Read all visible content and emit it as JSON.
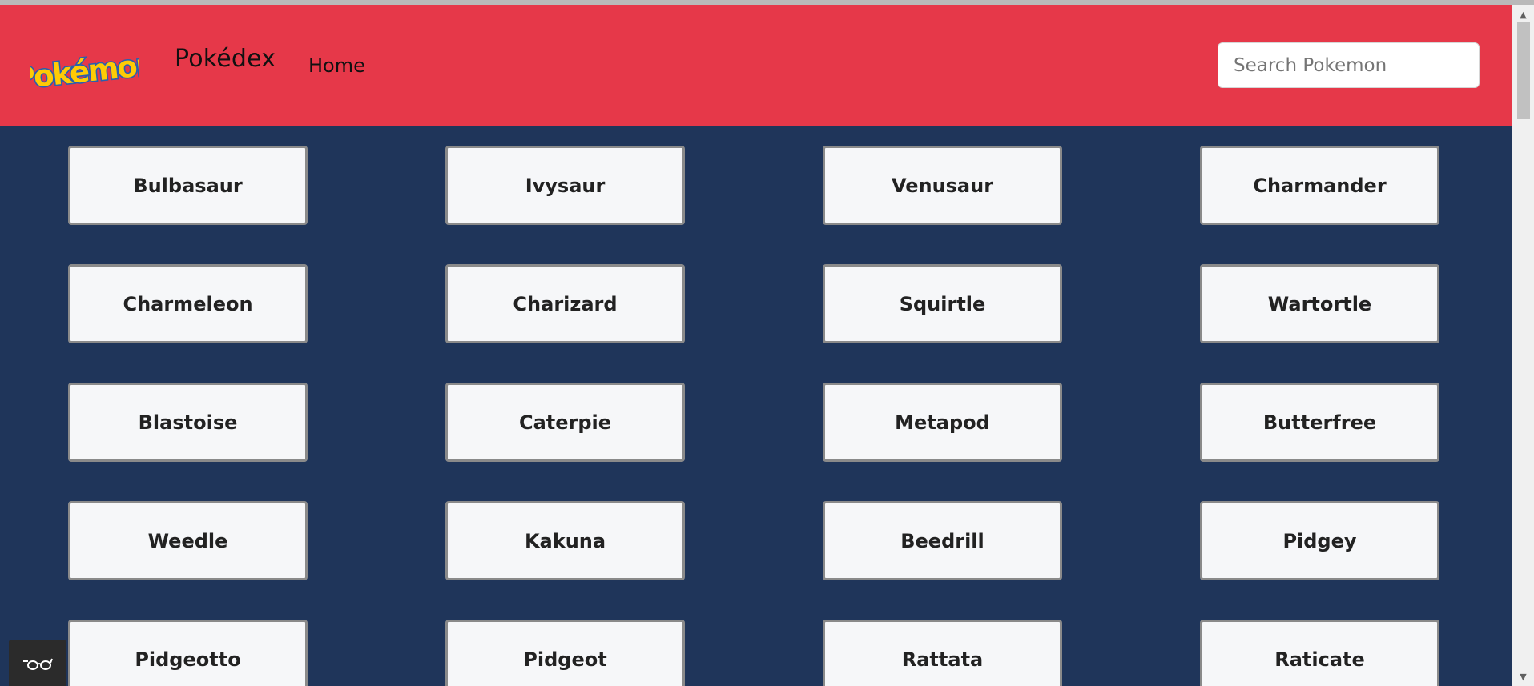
{
  "header": {
    "logo_text": "Pokémon",
    "brand": "Pokédex",
    "nav_home": "Home",
    "search_placeholder": "Search Pokemon"
  },
  "pokemon": [
    "Bulbasaur",
    "Ivysaur",
    "Venusaur",
    "Charmander",
    "Charmeleon",
    "Charizard",
    "Squirtle",
    "Wartortle",
    "Blastoise",
    "Caterpie",
    "Metapod",
    "Butterfree",
    "Weedle",
    "Kakuna",
    "Beedrill",
    "Pidgey",
    "Pidgeotto",
    "Pidgeot",
    "Rattata",
    "Raticate"
  ],
  "colors": {
    "header_bg": "#e63849",
    "page_bg": "#1f355a",
    "card_bg": "#f6f7f9",
    "logo_yellow": "#ffcb05",
    "logo_blue": "#2a5fae"
  },
  "icons": {
    "accessibility_toggle": "glasses-icon"
  }
}
